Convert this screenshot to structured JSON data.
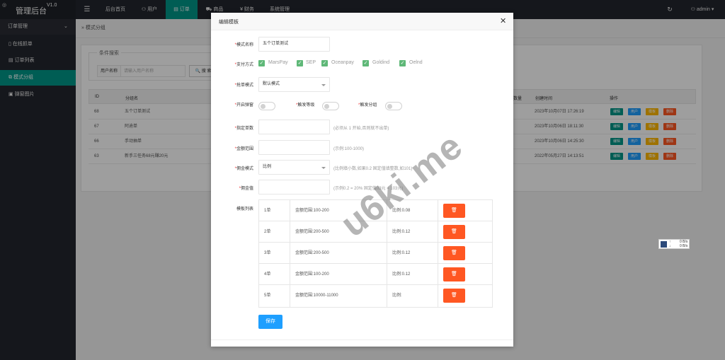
{
  "app": {
    "title": "管理后台",
    "version": "V1.0"
  },
  "topnav": {
    "menu_icon": "menu-icon",
    "items": [
      {
        "label": "后台首页",
        "icon": ""
      },
      {
        "label": "用户",
        "icon": "user-icon"
      },
      {
        "label": "订单",
        "icon": "order-icon",
        "active": true
      },
      {
        "label": "商品",
        "icon": "cart-icon"
      },
      {
        "label": "财务",
        "icon": "yen-icon"
      },
      {
        "label": "系统管理",
        "icon": ""
      }
    ],
    "refresh_icon": "refresh-icon",
    "user": "admin"
  },
  "sidebar": {
    "group": "订单管理",
    "items": [
      {
        "label": "在线抓单",
        "icon": "doc-icon"
      },
      {
        "label": "订单列表",
        "icon": "list-icon"
      },
      {
        "label": "模式分组",
        "icon": "group-icon",
        "active": true
      },
      {
        "label": "弹窗图片",
        "icon": "image-icon"
      }
    ]
  },
  "background": {
    "breadcrumb": "模式分组",
    "filter_title": "条件搜索",
    "filter_label": "用户名称",
    "filter_placeholder": "请输入用户名称",
    "search_label": "搜 索",
    "columns": [
      "ID",
      "分组名",
      "数量",
      "创建时间",
      "操作"
    ],
    "rows": [
      {
        "id": "68",
        "name": "五个订单测试",
        "created": "2023年10月07日 17:26:19"
      },
      {
        "id": "67",
        "name": "阿迪单",
        "created": "2023年10月06日 18:11:30"
      },
      {
        "id": "66",
        "name": "手动抽单",
        "created": "2023年10月06日 14:25:30"
      },
      {
        "id": "63",
        "name": "新手三任务68元赚20元",
        "created": "2022年05月27日 14:13:51"
      }
    ],
    "action_buttons": [
      "编辑",
      "用户",
      "模板",
      "删除"
    ],
    "action_colors": [
      "#009688",
      "#1e9fff",
      "#ffb800",
      "#ff5722"
    ]
  },
  "modal": {
    "title": "编辑模板",
    "close_icon": "close-icon",
    "fields": {
      "mode_name_label": "模式名称",
      "mode_name_value": "五个订单测试",
      "pay_label": "支付方式",
      "pay_options": [
        "MarsPay",
        "SEP",
        "Oceanpay",
        "Goldind",
        "Oelnd"
      ],
      "grab_mode_label": "抢单模式",
      "grab_mode_value": "默认模式",
      "popup_label": "开启弹窗",
      "trigger_level_label": "触发等级",
      "trigger_group_label": "触发分组",
      "fixed_count_label": "指定单数",
      "fixed_count_hint": "(必须从 1 开始,否则就不出单)",
      "amount_range_label": "金额范围",
      "amount_range_hint": "(示例:100-1000)",
      "commission_mode_label": "佣金模式",
      "commission_mode_value": "比例",
      "commission_mode_hint": "(比例填小数,如果0.2 固定值填整数,如101)",
      "commission_value_label": "佣金值",
      "commission_value_hint": "(示例0.2 = 20% 固定值03元 = 103元)",
      "template_list_label": "模板列表"
    },
    "tiers": [
      {
        "order": "1单",
        "range": "金额范围:100-200",
        "ratio": "比例:0.08"
      },
      {
        "order": "2单",
        "range": "金额范围:200-500",
        "ratio": "比例:0.12"
      },
      {
        "order": "3单",
        "range": "金额范围:200-500",
        "ratio": "比例:0.12"
      },
      {
        "order": "4单",
        "range": "金额范围:100-200",
        "ratio": "比例:0.12"
      },
      {
        "order": "5单",
        "range": "金额范围:10000-11000",
        "ratio": "比例:"
      }
    ],
    "delete_glyph": "🗑",
    "save_label": "保存"
  },
  "widget": {
    "up": "0 B/s",
    "down": "0 B/s"
  },
  "watermark": "u6ki.me"
}
